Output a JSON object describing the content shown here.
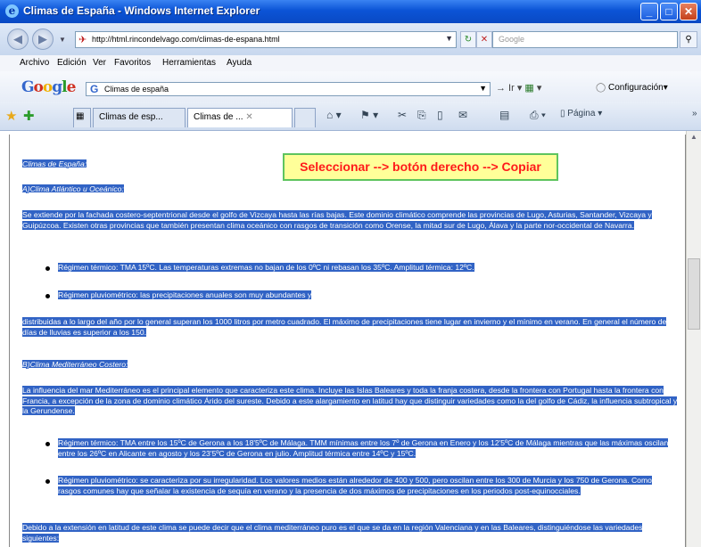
{
  "window": {
    "title": "Climas de España - Windows Internet Explorer"
  },
  "address_bar": {
    "url": "http://html.rincondelvago.com/climas-de-espana.html",
    "search_placeholder": "Google"
  },
  "menu": [
    "Archivo",
    "Edición",
    "Ver",
    "Favoritos",
    "Herramientas",
    "Ayuda"
  ],
  "google_bar": {
    "logo": "Google",
    "query": "Climas de españa",
    "settings_label": "Configuración"
  },
  "tabs": [
    {
      "label": "Climas de esp..."
    },
    {
      "label": "Climas de ..."
    }
  ],
  "toolbar": {
    "page_label": "Página"
  },
  "callout": "Seleccionar --> botón derecho --> Copiar",
  "article": {
    "title": "Climas de España:",
    "section1_title": "A)Clima Atlántico u Oceánico:",
    "p1": "Se extiende por la fachada costero-septentrional desde el golfo de Vizcaya hasta las rías bajas. Este dominio climático comprende las provincias de Lugo, Asturias, Santander, Vizcaya y Guipúzcoa. Existen otras provincias que también presentan clima oceánico con rasgos de transición como Orense, la mitad sur de Lugo, Álava y la parte nor-occidental de Navarra.",
    "b1": "Régimen térmico: TMA 15ºC. Las temperaturas extremas no bajan de los 0ºC ni rebasan los 35ºC. Amplitud térmica: 12ºC.",
    "b2": "Régimen pluviométrico: las precipitaciones anuales son muy abundantes y",
    "p2": "distribuidas a lo largo del año por lo general superan los 1000 litros por metro cuadrado. El máximo de precipitaciones tiene lugar en invierno y el mínimo en verano. En general el número de días de lluvias es superior a los 150.",
    "section2_title": "B)Clima Mediterráneo Costero:",
    "p3": "La influencia del mar Mediterráneo es el principal elemento que caracteriza este clima. Incluye las Islas Baleares y toda la franja costera, desde la frontera con Portugal hasta la frontera con Francia, a excepción de la zona de dominio climático Árido del sureste. Debido a este alargamiento en latitud hay que distinguir variedades como la del golfo de Cádiz, la influencia subtropical y la Gerundense.",
    "b3": "Régimen térmico: TMA entre los 15ºC de Gerona a los 18'5ºC de Málaga. TMM mínimas entre los 7º de Gerona en Enero y los 12'5ºC de Málaga mientras que las máximas oscilan entre los 26ºC en Alicante en agosto y los 23'5ºC de Gerona en julio. Amplitud térmica entre 14ºC y 15ºC.",
    "b4": "Régimen pluviométrico: se caracteriza por su irregularidad. Los valores medios están alrededor de 400 y 500, pero oscilan entre los 300 de Murcia y los 750 de Gerona. Como rasgos comunes hay que señalar la existencia de sequía en verano y la presencia de dos máximos de precipitaciones en los periodos post-equinocciales.",
    "p4": "Debido a la extensión en latitud de este clima se puede decir que el clima mediterráneo puro es el que se da en la región Valenciana y en las Baleares, distinguiéndose las variedades siguientes:"
  }
}
